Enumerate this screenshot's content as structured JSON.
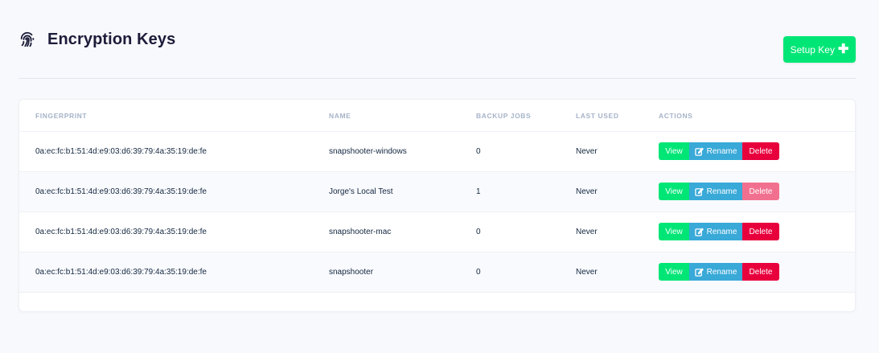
{
  "page": {
    "title": "Encryption Keys",
    "title_icon": "fingerprint-icon",
    "setup_button_label": "Setup Key",
    "setup_button_icon": "plus-icon"
  },
  "table": {
    "headers": {
      "fingerprint": "FINGERPRINT",
      "name": "NAME",
      "backup_jobs": "BACKUP JOBS",
      "last_used": "LAST USED",
      "actions": "ACTIONS"
    },
    "rows": [
      {
        "fingerprint": "0a:ec:fc:b1:51:4d:e9:03:d6:39:79:4a:35:19:de:fe",
        "name": "snapshooter-windows",
        "backup_jobs": "0",
        "last_used": "Never",
        "delete_disabled": false
      },
      {
        "fingerprint": "0a:ec:fc:b1:51:4d:e9:03:d6:39:79:4a:35:19:de:fe",
        "name": "Jorge's Local Test",
        "backup_jobs": "1",
        "last_used": "Never",
        "delete_disabled": true
      },
      {
        "fingerprint": "0a:ec:fc:b1:51:4d:e9:03:d6:39:79:4a:35:19:de:fe",
        "name": "snapshooter-mac",
        "backup_jobs": "0",
        "last_used": "Never",
        "delete_disabled": false
      },
      {
        "fingerprint": "0a:ec:fc:b1:51:4d:e9:03:d6:39:79:4a:35:19:de:fe",
        "name": "snapshooter",
        "backup_jobs": "0",
        "last_used": "Never",
        "delete_disabled": false
      }
    ],
    "actions": {
      "view_label": "View",
      "rename_label": "Rename",
      "rename_icon": "edit-icon",
      "delete_label": "Delete"
    }
  },
  "colors": {
    "primary_green": "#00e676",
    "info_blue": "#39a9d8",
    "danger_red": "#e8003d",
    "danger_red_disabled": "#f2708f"
  }
}
